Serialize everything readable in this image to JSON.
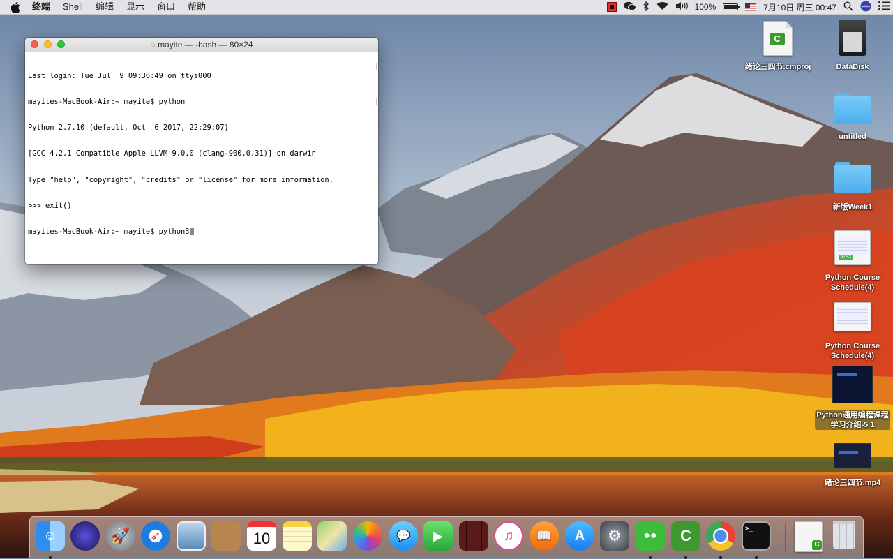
{
  "menubar": {
    "apple_icon": "apple-icon",
    "app_name": "终端",
    "menus": [
      "Shell",
      "编辑",
      "显示",
      "窗口",
      "帮助"
    ],
    "status": {
      "battery_percent": "100%",
      "clock": "7月10日 周三  00:47",
      "icons": [
        "recorder-icon",
        "wechat-icon",
        "bluetooth-icon",
        "wifi-icon",
        "volume-icon",
        "battery-icon",
        "us-flag-icon",
        "search-icon",
        "siri-icon",
        "notification-list-icon"
      ]
    }
  },
  "terminal": {
    "title": "mayite — -bash — 80×24",
    "lines": [
      "Last login: Tue Jul  9 09:36:49 on ttys000",
      "mayites-MacBook-Air:~ mayite$ python",
      "Python 2.7.10 (default, Oct  6 2017, 22:29:07)",
      "[GCC 4.2.1 Compatible Apple LLVM 9.0.0 (clang-900.0.31)] on darwin",
      "Type \"help\", \"copyright\", \"credits\" or \"license\" for more information.",
      ">>> exit()",
      "mayites-MacBook-Air:~ mayite$ python3"
    ]
  },
  "desktop": {
    "icons": [
      {
        "label": "绪论三四节.cmproj",
        "type": "cmproj"
      },
      {
        "label": "DataDisk",
        "type": "disk"
      },
      {
        "label": "untitled",
        "type": "folder"
      },
      {
        "label": "新版Week1",
        "type": "folder"
      },
      {
        "label": "Python Course Schedule(4)",
        "type": "xlsx"
      },
      {
        "label": "Python Course Schedule(4)",
        "type": "sheet"
      },
      {
        "label": "Python通用编程课程学习介绍-5 1",
        "type": "video"
      },
      {
        "label": "绪论三四节.mp4",
        "type": "video"
      }
    ]
  },
  "dock": {
    "items": [
      {
        "name": "finder",
        "label": "Finder",
        "running": true
      },
      {
        "name": "siri",
        "label": "Siri",
        "running": false
      },
      {
        "name": "launchpad",
        "label": "Launchpad",
        "running": false
      },
      {
        "name": "safari",
        "label": "Safari",
        "running": false
      },
      {
        "name": "preview",
        "label": "Preview",
        "running": false
      },
      {
        "name": "contacts",
        "label": "Contacts",
        "running": false
      },
      {
        "name": "calendar",
        "label": "10",
        "running": false
      },
      {
        "name": "notes",
        "label": "Notes",
        "running": false
      },
      {
        "name": "maps",
        "label": "Maps",
        "running": false
      },
      {
        "name": "photos",
        "label": "Photos",
        "running": false
      },
      {
        "name": "messages",
        "label": "Messages",
        "running": false
      },
      {
        "name": "facetime",
        "label": "FaceTime",
        "running": false
      },
      {
        "name": "photo-booth",
        "label": "Photo Booth",
        "running": false
      },
      {
        "name": "itunes",
        "label": "iTunes",
        "running": false
      },
      {
        "name": "ibooks",
        "label": "iBooks",
        "running": false
      },
      {
        "name": "app-store",
        "label": "App Store",
        "running": false
      },
      {
        "name": "system-preferences",
        "label": "System Preferences",
        "running": false
      },
      {
        "name": "wechat",
        "label": "WeChat",
        "running": true
      },
      {
        "name": "camtasia",
        "label": "Camtasia",
        "running": true
      },
      {
        "name": "chrome",
        "label": "Chrome",
        "running": true
      },
      {
        "name": "terminal",
        "label": "Terminal",
        "running": true
      },
      {
        "name": "document",
        "label": "Document",
        "running": false
      },
      {
        "name": "trash",
        "label": "Trash",
        "running": false
      }
    ]
  }
}
